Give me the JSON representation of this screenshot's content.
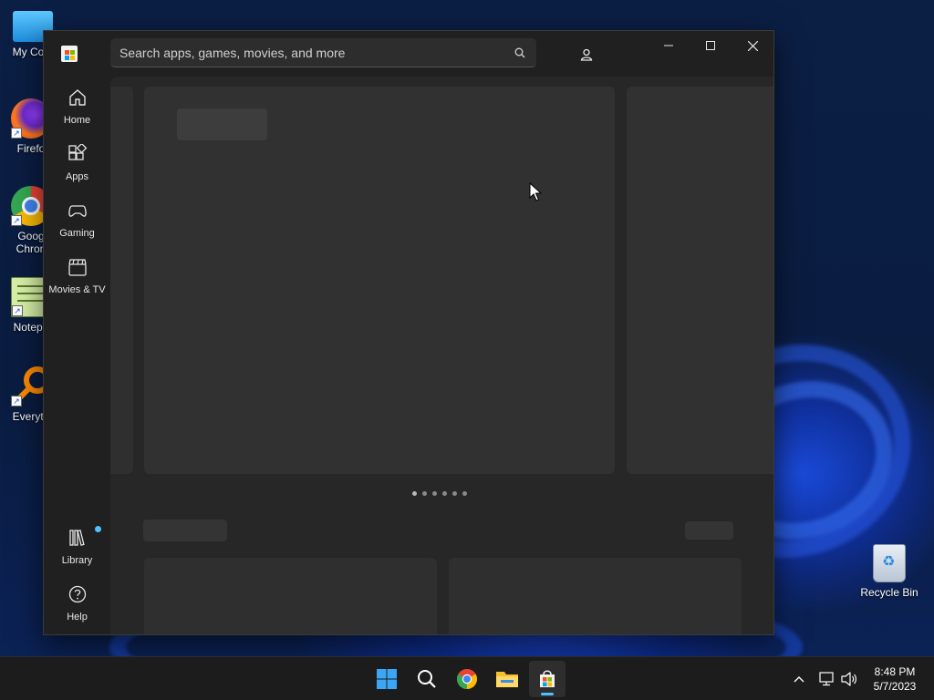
{
  "desktop": {
    "icons": [
      {
        "label": "My Com",
        "icon": "computer-icon"
      },
      {
        "label": "Firefo",
        "icon": "firefox-icon"
      },
      {
        "label": "Goog Chron",
        "icon": "chrome-icon"
      },
      {
        "label": "Notepa",
        "icon": "notepad-icon"
      },
      {
        "label": "Everyth",
        "icon": "everything-icon"
      }
    ],
    "recycle_bin": {
      "label": "Recycle Bin",
      "icon": "recycle-bin-icon"
    }
  },
  "store": {
    "search": {
      "placeholder": "Search apps, games, movies, and more"
    },
    "nav": [
      {
        "label": "Home",
        "icon": "home-icon"
      },
      {
        "label": "Apps",
        "icon": "apps-icon"
      },
      {
        "label": "Gaming",
        "icon": "gamepad-icon"
      },
      {
        "label": "Movies & TV",
        "icon": "clapperboard-icon"
      }
    ],
    "nav_bottom": [
      {
        "label": "Library",
        "icon": "library-icon",
        "has_badge": true
      },
      {
        "label": "Help",
        "icon": "help-icon"
      }
    ],
    "carousel": {
      "dot_count": 6,
      "active_index": 0
    },
    "colors": {
      "background": "#202020",
      "content": "#272727",
      "accent": "#4cc2ff"
    }
  },
  "taskbar": {
    "apps": [
      {
        "name": "start",
        "icon": "windows-start-icon"
      },
      {
        "name": "search",
        "icon": "search-icon"
      },
      {
        "name": "chrome",
        "icon": "chrome-icon"
      },
      {
        "name": "file-explorer",
        "icon": "folder-icon"
      },
      {
        "name": "microsoft-store",
        "icon": "store-icon",
        "active": true
      }
    ],
    "tray": {
      "time": "8:48 PM",
      "date": "5/7/2023"
    }
  }
}
